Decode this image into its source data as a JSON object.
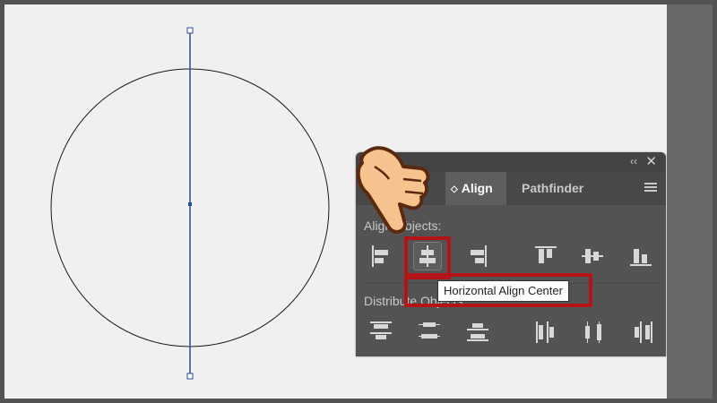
{
  "canvas": {
    "background": "#f0f0f0",
    "object": "circle-with-selected-vertical-line",
    "line_color": "#2e4a9a"
  },
  "panel": {
    "collapse_glyph": "‹‹",
    "close_glyph": "✕",
    "tabs": [
      {
        "label": "Transform",
        "visible_text": "m",
        "active": false
      },
      {
        "label": "Align",
        "active": true
      },
      {
        "label": "Pathfinder",
        "active": false
      }
    ],
    "menu_icon": "panel-menu-icon",
    "align_objects_label": "Align Objects:",
    "align_objects_visible": "Alig   Objects:",
    "distribute_objects_label": "Distribute Objects:",
    "distribute_visible": "Distribute Obj",
    "align_buttons": [
      {
        "name": "horizontal-align-left",
        "icon": "horizontal-align-left-icon"
      },
      {
        "name": "horizontal-align-center",
        "icon": "horizontal-align-center-icon",
        "highlighted": true
      },
      {
        "name": "horizontal-align-right",
        "icon": "horizontal-align-right-icon"
      },
      {
        "name": "vertical-align-top",
        "icon": "vertical-align-top-icon"
      },
      {
        "name": "vertical-align-center",
        "icon": "vertical-align-center-icon"
      },
      {
        "name": "vertical-align-bottom",
        "icon": "vertical-align-bottom-icon"
      }
    ],
    "distribute_buttons": [
      {
        "name": "vertical-distribute-top",
        "icon": "vertical-distribute-top-icon"
      },
      {
        "name": "vertical-distribute-center",
        "icon": "vertical-distribute-center-icon"
      },
      {
        "name": "vertical-distribute-bottom",
        "icon": "vertical-distribute-bottom-icon"
      },
      {
        "name": "horizontal-distribute-left",
        "icon": "horizontal-distribute-left-icon"
      },
      {
        "name": "horizontal-distribute-center",
        "icon": "horizontal-distribute-center-icon"
      },
      {
        "name": "horizontal-distribute-right",
        "icon": "horizontal-distribute-right-icon"
      }
    ]
  },
  "tooltip": {
    "text": "Horizontal Align Center"
  },
  "annotation": {
    "highlight_color": "#b41318",
    "cursor": "pointing-hand-icon"
  }
}
